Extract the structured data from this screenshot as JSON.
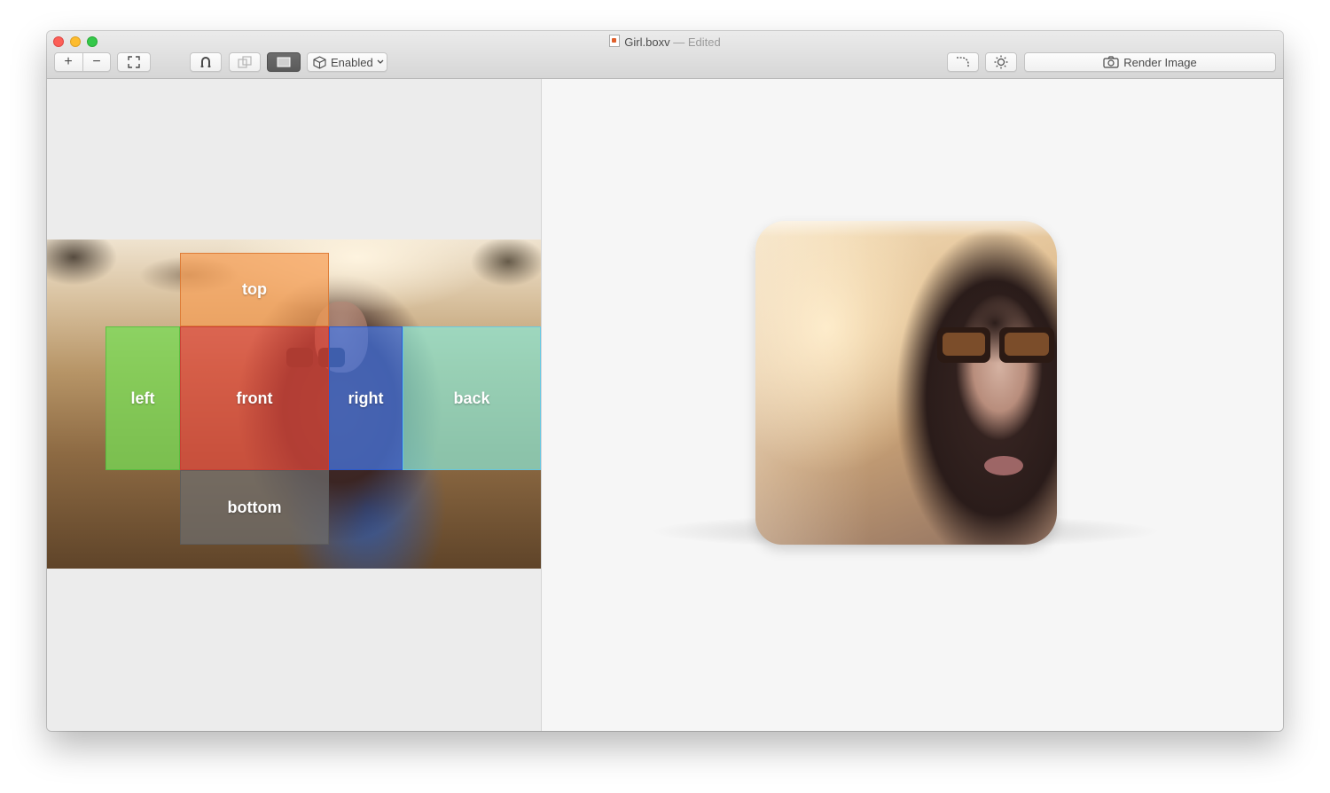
{
  "window": {
    "title": "Girl.boxv",
    "title_separator": "—",
    "status": "Edited"
  },
  "toolbar": {
    "zoom_in": "+",
    "zoom_out": "−",
    "mode_select": {
      "value": "Enabled",
      "options": [
        "Enabled"
      ]
    },
    "render_label": "Render Image",
    "icons": {
      "zoom_in": "plus-icon",
      "zoom_out": "minus-icon",
      "fit": "fit-to-window-icon",
      "snap": "magnet-icon",
      "duplicate": "duplicate-icon",
      "view": "rectangle-view-icon",
      "box": "cube-icon",
      "corner": "corner-radius-icon",
      "light": "sun-icon",
      "camera": "camera-icon"
    }
  },
  "layout_editor": {
    "faces": {
      "top": "top",
      "left": "left",
      "front": "front",
      "right": "right",
      "back": "back",
      "bottom": "bottom"
    },
    "colors": {
      "top": "#f69e54",
      "left": "#77de56",
      "front": "#e0483c",
      "right": "#4678e6",
      "back": "#8ce6d2",
      "bottom": "#6e6e6e"
    }
  }
}
